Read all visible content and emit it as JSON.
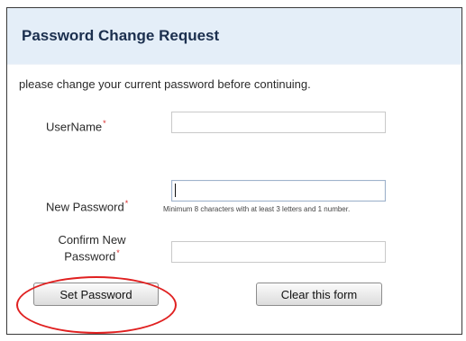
{
  "header": {
    "title": "Password Change Request"
  },
  "form": {
    "instruction": "please change your current password before continuing.",
    "username_label": "UserName",
    "username_value": "",
    "new_password_label": "New Password",
    "new_password_value": "",
    "password_hint": "Minimum 8 characters with at least 3 letters and 1 number.",
    "confirm_label_line1": "Confirm New",
    "confirm_label_line2": "Password",
    "confirm_value": "",
    "required_marker": "*"
  },
  "buttons": {
    "set_password": "Set Password",
    "clear_form": "Clear this form"
  },
  "colors": {
    "header_background": "#e4eef8",
    "title_text": "#1b2f4e",
    "required_marker": "#d92a2a",
    "highlight_annotation": "#e02020"
  }
}
